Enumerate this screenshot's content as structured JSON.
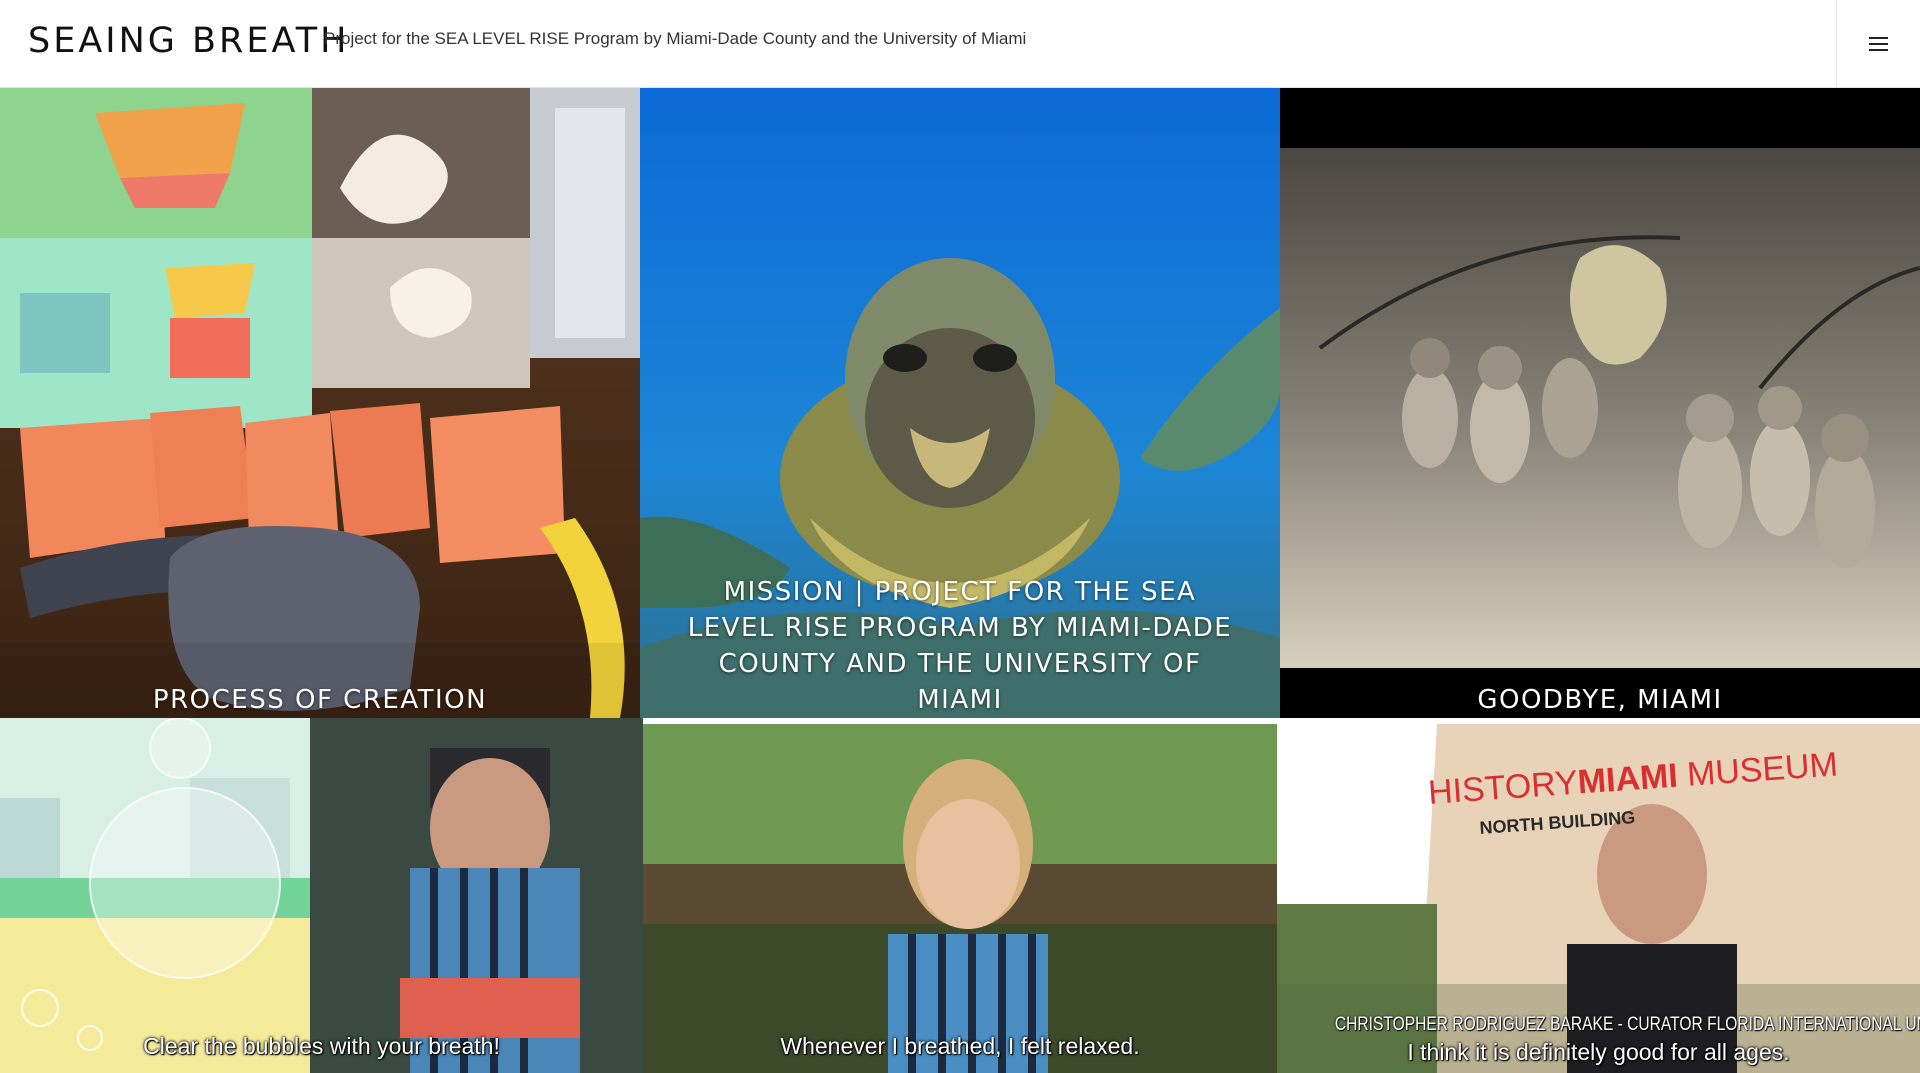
{
  "header": {
    "site_title": "SEAING BREATH",
    "tagline": "Project for the SEA LEVEL RISE Program by Miami-Dade County and the University of Miami",
    "menu_icon": "hamburger-menu-icon"
  },
  "tiles": {
    "process": {
      "title": "PROCESS OF CREATION"
    },
    "mission": {
      "title": "MISSION | PROJECT FOR THE SEA LEVEL RISE PROGRAM BY MIAMI-DADE COUNTY AND THE UNIVERSITY OF MIAMI"
    },
    "goodbye": {
      "title": "GOODBYE, MIAMI"
    },
    "bubbles": {
      "caption": "Clear the bubbles with your breath!"
    },
    "relaxed": {
      "caption": "Whenever I breathed, I felt relaxed."
    },
    "curator": {
      "sign_history": "HISTORY",
      "sign_miami": "MIAMI",
      "sign_museum": " MUSEUM",
      "sign_building": "NORTH BUILDING",
      "caption_name": "CHRISTOPHER RODRIGUEZ BARAKE - CURATOR FLORIDA INTERNATIONAL UNIVERSITY -",
      "caption": "I think it is definitely good for all ages."
    }
  }
}
